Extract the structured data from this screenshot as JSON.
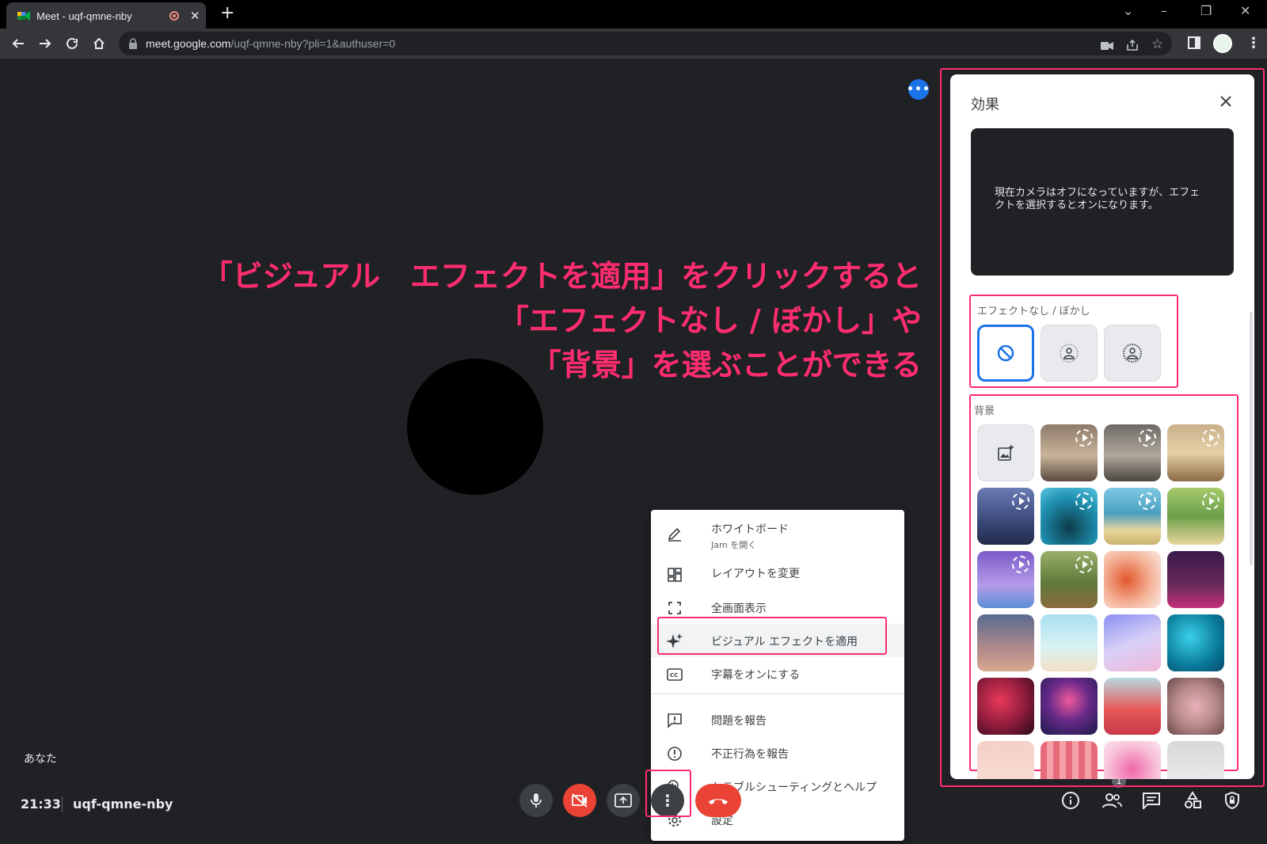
{
  "browser": {
    "tab_title": "Meet - uqf-qmne-nby",
    "url_host": "meet.google.com",
    "url_path": "/uqf-qmne-nby?pli=1&authuser=0"
  },
  "annotation": {
    "line1": "「ビジュアル　エフェクトを適用」をクリックすると",
    "line2": "「エフェクトなし / ぼかし」や",
    "line3": "「背景」を選ぶことができる",
    "color": "#ff2d6f"
  },
  "stage": {
    "self_label": "あなた",
    "time": "21:33",
    "meeting_code": "uqf-qmne-nby",
    "participants_count": "1"
  },
  "menu": {
    "items": [
      {
        "label": "ホワイトボード",
        "sub": "Jam を開く",
        "icon": "pencil-icon"
      },
      {
        "label": "レイアウトを変更",
        "icon": "layout-icon"
      },
      {
        "label": "全画面表示",
        "icon": "fullscreen-icon"
      },
      {
        "label": "ビジュアル エフェクトを適用",
        "icon": "sparkle-icon"
      },
      {
        "label": "字幕をオンにする",
        "icon": "captions-icon"
      },
      {
        "label": "問題を報告",
        "icon": "feedback-icon"
      },
      {
        "label": "不正行為を報告",
        "icon": "alert-icon"
      },
      {
        "label": "トラブルシューティングとヘルプ",
        "icon": "troubleshoot-icon"
      },
      {
        "label": "設定",
        "icon": "gear-icon"
      }
    ]
  },
  "effects": {
    "title": "効果",
    "preview_message": "現在カメラはオフになっていますが、エフェクトを選択するとオンになります。",
    "blur_section": "エフェクトなし / ぼかし",
    "background_section": "背景"
  },
  "colors": {
    "accent": "#1a73e8",
    "danger": "#ea4335",
    "highlight": "#ff2d6f"
  }
}
